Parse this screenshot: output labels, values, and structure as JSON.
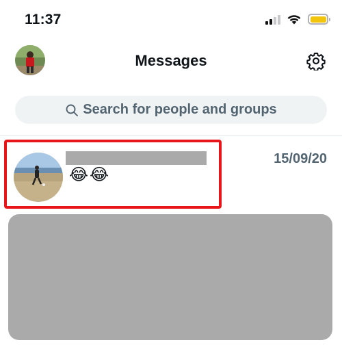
{
  "status_bar": {
    "time": "11:37",
    "icons": [
      "cellular-signal-icon",
      "wifi-icon",
      "battery-icon"
    ],
    "battery_color": "#f2c50c"
  },
  "header": {
    "title": "Messages",
    "left_icon": "profile-avatar",
    "right_icon": "gear-icon"
  },
  "search": {
    "placeholder": "Search for people and groups",
    "icon": "search-icon"
  },
  "conversations": [
    {
      "name": "",
      "preview": "😂😂",
      "date": "15/09/20",
      "highlighted": true,
      "highlight_color": "#e8161b"
    }
  ],
  "colors": {
    "accent_text": "#0f1419",
    "secondary_text": "#536471",
    "search_bg": "#eff3f4",
    "redaction": "#aaaaaa"
  }
}
